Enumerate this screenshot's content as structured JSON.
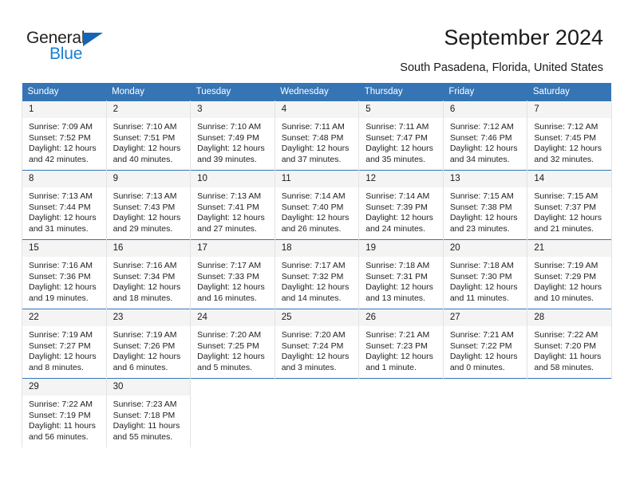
{
  "brand": {
    "name_dark": "General",
    "name_blue": "Blue",
    "accent_blue": "#1a7fd4",
    "triangle_blue": "#1565b5"
  },
  "header": {
    "title": "September 2024",
    "subtitle": "South Pasadena, Florida, United States"
  },
  "calendar": {
    "header_bg": "#3575b5",
    "daynum_bg": "#f4f4f4",
    "weekday_headers": [
      "Sunday",
      "Monday",
      "Tuesday",
      "Wednesday",
      "Thursday",
      "Friday",
      "Saturday"
    ],
    "weeks": [
      [
        {
          "day": "1",
          "sunrise": "Sunrise: 7:09 AM",
          "sunset": "Sunset: 7:52 PM",
          "daylight_line1": "Daylight: 12 hours",
          "daylight_line2": "and 42 minutes."
        },
        {
          "day": "2",
          "sunrise": "Sunrise: 7:10 AM",
          "sunset": "Sunset: 7:51 PM",
          "daylight_line1": "Daylight: 12 hours",
          "daylight_line2": "and 40 minutes."
        },
        {
          "day": "3",
          "sunrise": "Sunrise: 7:10 AM",
          "sunset": "Sunset: 7:49 PM",
          "daylight_line1": "Daylight: 12 hours",
          "daylight_line2": "and 39 minutes."
        },
        {
          "day": "4",
          "sunrise": "Sunrise: 7:11 AM",
          "sunset": "Sunset: 7:48 PM",
          "daylight_line1": "Daylight: 12 hours",
          "daylight_line2": "and 37 minutes."
        },
        {
          "day": "5",
          "sunrise": "Sunrise: 7:11 AM",
          "sunset": "Sunset: 7:47 PM",
          "daylight_line1": "Daylight: 12 hours",
          "daylight_line2": "and 35 minutes."
        },
        {
          "day": "6",
          "sunrise": "Sunrise: 7:12 AM",
          "sunset": "Sunset: 7:46 PM",
          "daylight_line1": "Daylight: 12 hours",
          "daylight_line2": "and 34 minutes."
        },
        {
          "day": "7",
          "sunrise": "Sunrise: 7:12 AM",
          "sunset": "Sunset: 7:45 PM",
          "daylight_line1": "Daylight: 12 hours",
          "daylight_line2": "and 32 minutes."
        }
      ],
      [
        {
          "day": "8",
          "sunrise": "Sunrise: 7:13 AM",
          "sunset": "Sunset: 7:44 PM",
          "daylight_line1": "Daylight: 12 hours",
          "daylight_line2": "and 31 minutes."
        },
        {
          "day": "9",
          "sunrise": "Sunrise: 7:13 AM",
          "sunset": "Sunset: 7:43 PM",
          "daylight_line1": "Daylight: 12 hours",
          "daylight_line2": "and 29 minutes."
        },
        {
          "day": "10",
          "sunrise": "Sunrise: 7:13 AM",
          "sunset": "Sunset: 7:41 PM",
          "daylight_line1": "Daylight: 12 hours",
          "daylight_line2": "and 27 minutes."
        },
        {
          "day": "11",
          "sunrise": "Sunrise: 7:14 AM",
          "sunset": "Sunset: 7:40 PM",
          "daylight_line1": "Daylight: 12 hours",
          "daylight_line2": "and 26 minutes."
        },
        {
          "day": "12",
          "sunrise": "Sunrise: 7:14 AM",
          "sunset": "Sunset: 7:39 PM",
          "daylight_line1": "Daylight: 12 hours",
          "daylight_line2": "and 24 minutes."
        },
        {
          "day": "13",
          "sunrise": "Sunrise: 7:15 AM",
          "sunset": "Sunset: 7:38 PM",
          "daylight_line1": "Daylight: 12 hours",
          "daylight_line2": "and 23 minutes."
        },
        {
          "day": "14",
          "sunrise": "Sunrise: 7:15 AM",
          "sunset": "Sunset: 7:37 PM",
          "daylight_line1": "Daylight: 12 hours",
          "daylight_line2": "and 21 minutes."
        }
      ],
      [
        {
          "day": "15",
          "sunrise": "Sunrise: 7:16 AM",
          "sunset": "Sunset: 7:36 PM",
          "daylight_line1": "Daylight: 12 hours",
          "daylight_line2": "and 19 minutes."
        },
        {
          "day": "16",
          "sunrise": "Sunrise: 7:16 AM",
          "sunset": "Sunset: 7:34 PM",
          "daylight_line1": "Daylight: 12 hours",
          "daylight_line2": "and 18 minutes."
        },
        {
          "day": "17",
          "sunrise": "Sunrise: 7:17 AM",
          "sunset": "Sunset: 7:33 PM",
          "daylight_line1": "Daylight: 12 hours",
          "daylight_line2": "and 16 minutes."
        },
        {
          "day": "18",
          "sunrise": "Sunrise: 7:17 AM",
          "sunset": "Sunset: 7:32 PM",
          "daylight_line1": "Daylight: 12 hours",
          "daylight_line2": "and 14 minutes."
        },
        {
          "day": "19",
          "sunrise": "Sunrise: 7:18 AM",
          "sunset": "Sunset: 7:31 PM",
          "daylight_line1": "Daylight: 12 hours",
          "daylight_line2": "and 13 minutes."
        },
        {
          "day": "20",
          "sunrise": "Sunrise: 7:18 AM",
          "sunset": "Sunset: 7:30 PM",
          "daylight_line1": "Daylight: 12 hours",
          "daylight_line2": "and 11 minutes."
        },
        {
          "day": "21",
          "sunrise": "Sunrise: 7:19 AM",
          "sunset": "Sunset: 7:29 PM",
          "daylight_line1": "Daylight: 12 hours",
          "daylight_line2": "and 10 minutes."
        }
      ],
      [
        {
          "day": "22",
          "sunrise": "Sunrise: 7:19 AM",
          "sunset": "Sunset: 7:27 PM",
          "daylight_line1": "Daylight: 12 hours",
          "daylight_line2": "and 8 minutes."
        },
        {
          "day": "23",
          "sunrise": "Sunrise: 7:19 AM",
          "sunset": "Sunset: 7:26 PM",
          "daylight_line1": "Daylight: 12 hours",
          "daylight_line2": "and 6 minutes."
        },
        {
          "day": "24",
          "sunrise": "Sunrise: 7:20 AM",
          "sunset": "Sunset: 7:25 PM",
          "daylight_line1": "Daylight: 12 hours",
          "daylight_line2": "and 5 minutes."
        },
        {
          "day": "25",
          "sunrise": "Sunrise: 7:20 AM",
          "sunset": "Sunset: 7:24 PM",
          "daylight_line1": "Daylight: 12 hours",
          "daylight_line2": "and 3 minutes."
        },
        {
          "day": "26",
          "sunrise": "Sunrise: 7:21 AM",
          "sunset": "Sunset: 7:23 PM",
          "daylight_line1": "Daylight: 12 hours",
          "daylight_line2": "and 1 minute."
        },
        {
          "day": "27",
          "sunrise": "Sunrise: 7:21 AM",
          "sunset": "Sunset: 7:22 PM",
          "daylight_line1": "Daylight: 12 hours",
          "daylight_line2": "and 0 minutes."
        },
        {
          "day": "28",
          "sunrise": "Sunrise: 7:22 AM",
          "sunset": "Sunset: 7:20 PM",
          "daylight_line1": "Daylight: 11 hours",
          "daylight_line2": "and 58 minutes."
        }
      ],
      [
        {
          "day": "29",
          "sunrise": "Sunrise: 7:22 AM",
          "sunset": "Sunset: 7:19 PM",
          "daylight_line1": "Daylight: 11 hours",
          "daylight_line2": "and 56 minutes."
        },
        {
          "day": "30",
          "sunrise": "Sunrise: 7:23 AM",
          "sunset": "Sunset: 7:18 PM",
          "daylight_line1": "Daylight: 11 hours",
          "daylight_line2": "and 55 minutes."
        },
        null,
        null,
        null,
        null,
        null
      ]
    ]
  }
}
